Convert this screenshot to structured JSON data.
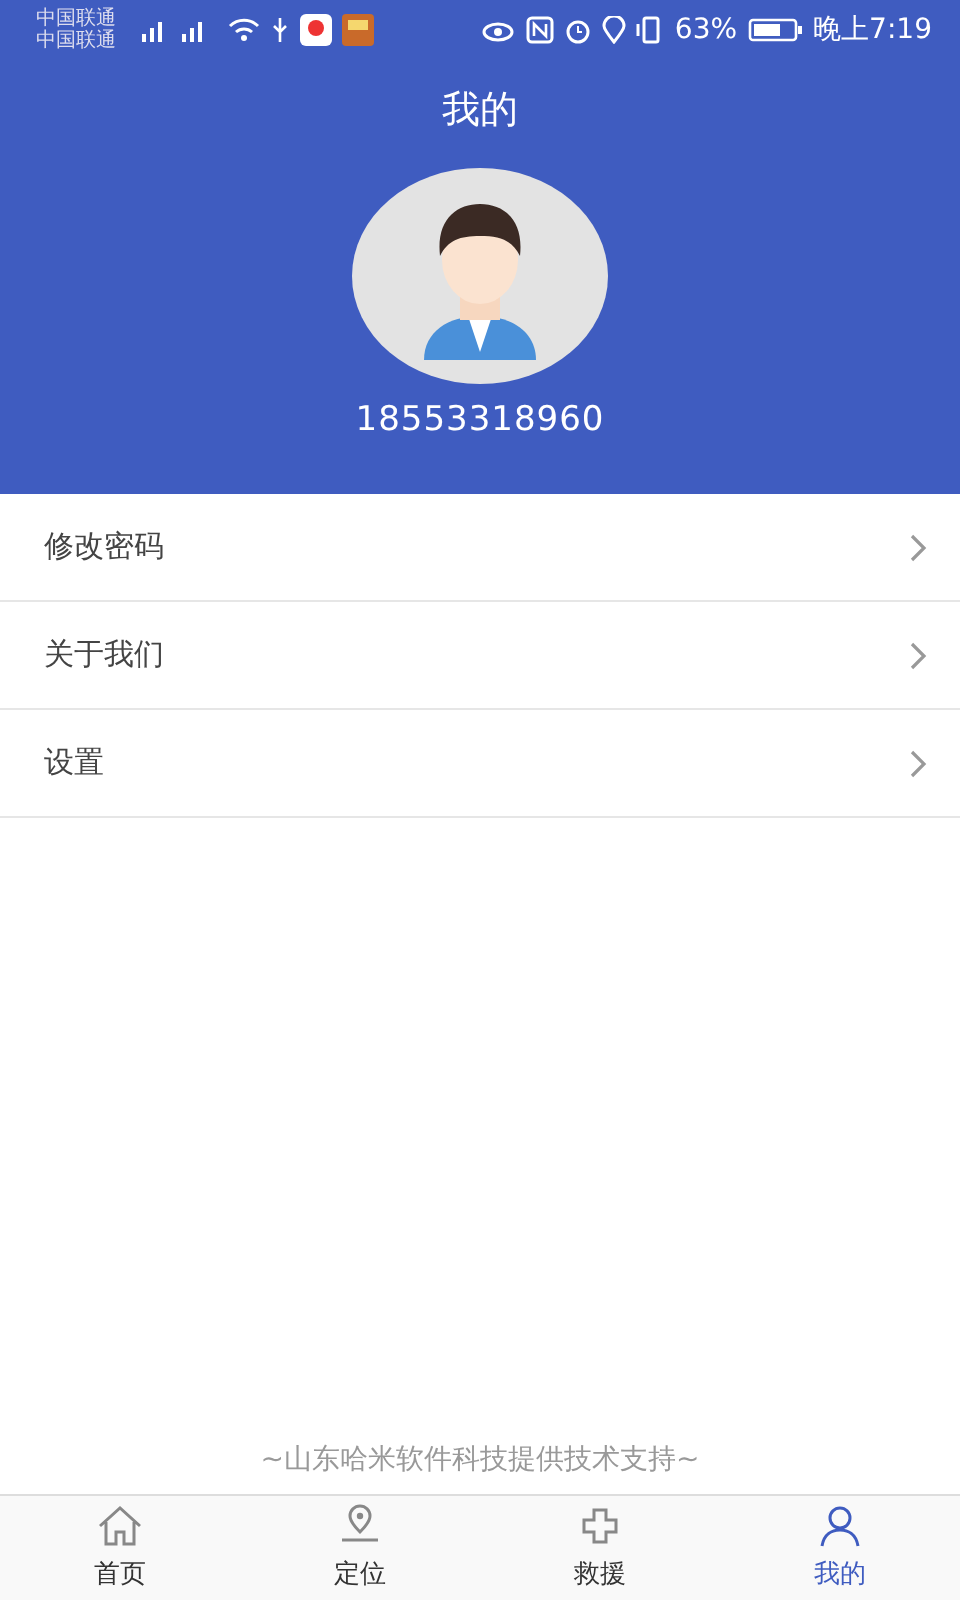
{
  "status_bar": {
    "carriers": [
      "中国联通",
      "中国联通"
    ],
    "battery_percent": "63%",
    "time": "晚上7:19"
  },
  "header": {
    "title": "我的",
    "phone": "18553318960"
  },
  "menu": [
    {
      "label": "修改密码"
    },
    {
      "label": "关于我们"
    },
    {
      "label": "设置"
    }
  ],
  "footer": {
    "credit": "~山东哈米软件科技提供技术支持~"
  },
  "tabs": [
    {
      "label": "首页",
      "kind": "home",
      "selected": false
    },
    {
      "label": "定位",
      "kind": "location",
      "selected": false
    },
    {
      "label": "救援",
      "kind": "rescue",
      "selected": false
    },
    {
      "label": "我的",
      "kind": "profile",
      "selected": true
    }
  ]
}
